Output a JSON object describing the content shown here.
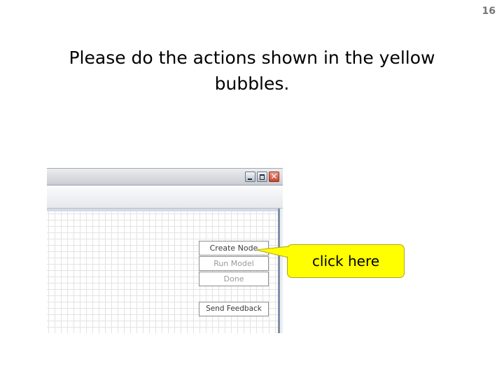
{
  "slide": {
    "number": "16",
    "title": "Please do the actions shown in the yellow bubbles."
  },
  "window": {
    "close_glyph": "✕",
    "buttons": {
      "create_node": "Create Node",
      "run_model": "Run Model",
      "done": "Done",
      "send_feedback": "Send Feedback"
    }
  },
  "callout": {
    "text": "click here",
    "color": "#ffff00"
  },
  "icons": [
    "minimize-icon",
    "maximize-icon",
    "close-icon"
  ]
}
